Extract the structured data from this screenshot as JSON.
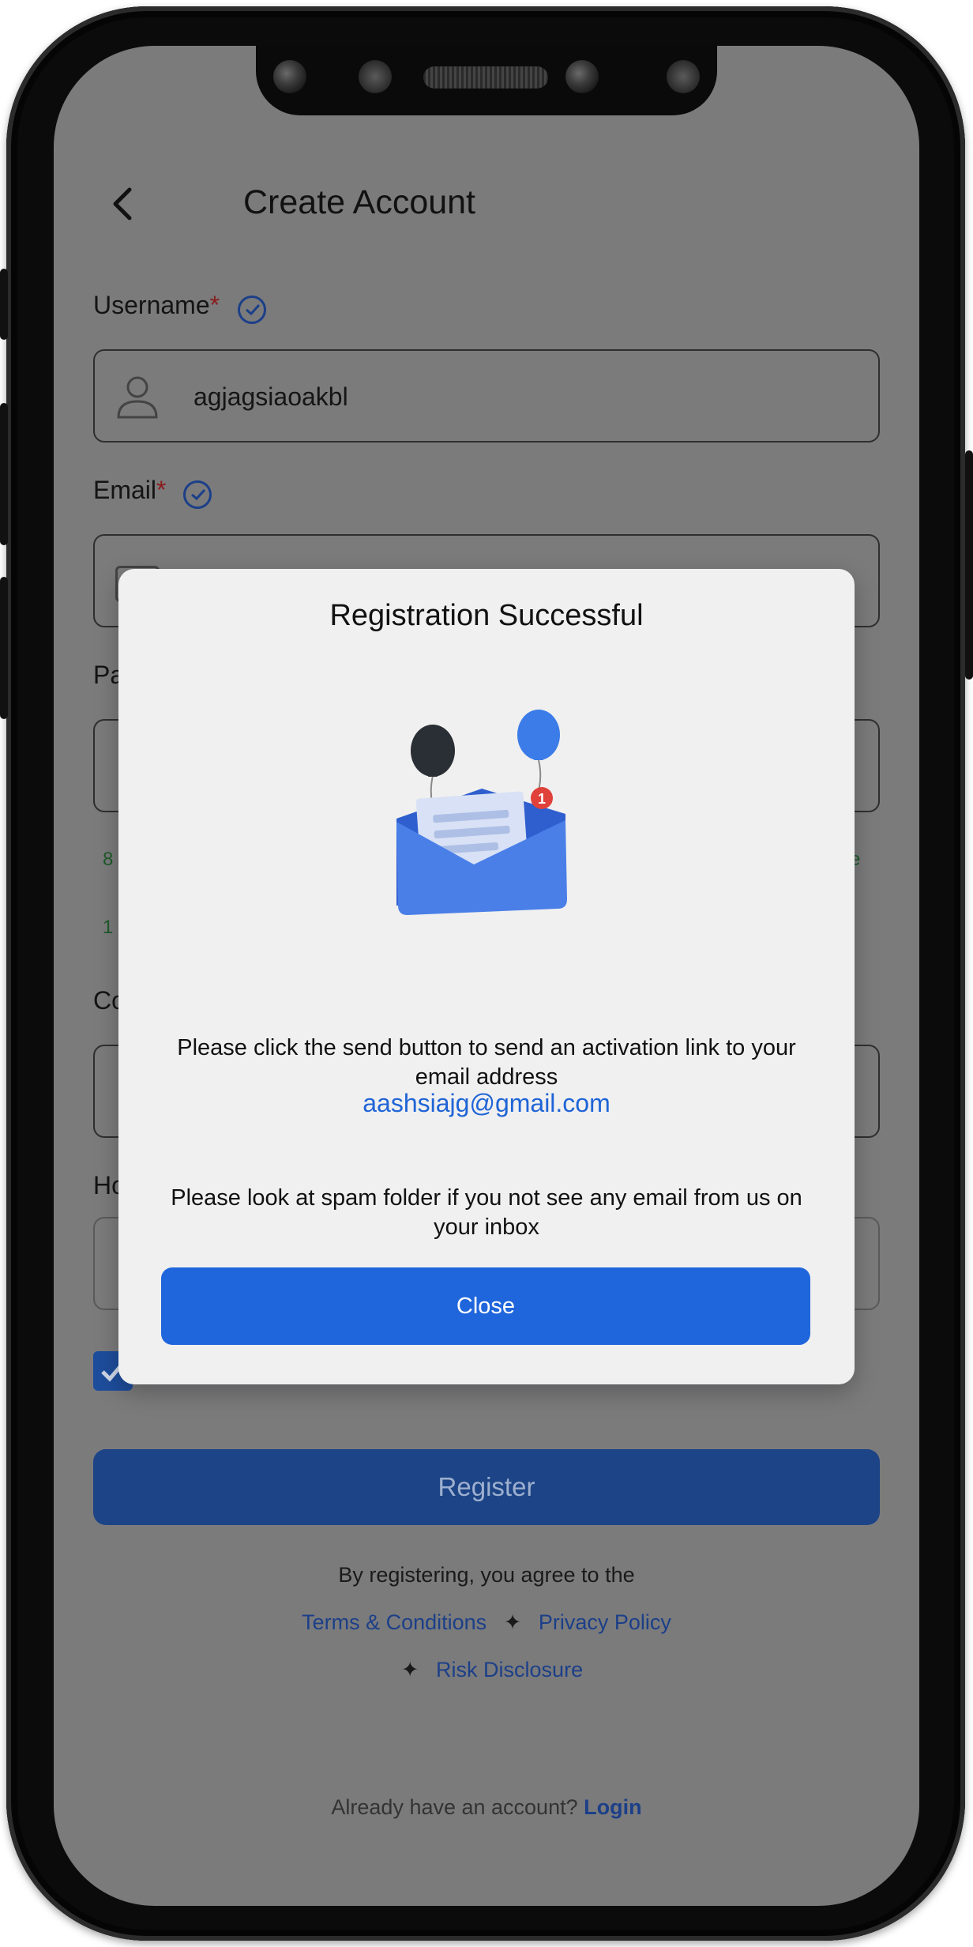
{
  "header": {
    "title": "Create Account"
  },
  "form": {
    "username_label": "Username",
    "email_label": "Email",
    "required_mark": "*",
    "username_value": "agjagsiaoakbl",
    "password_label_partial": "Pa",
    "confirm_label_partial": "Co",
    "hint_label_partial": "Ho",
    "helper_left_1": "8",
    "helper_left_2": "1",
    "helper_right_1": "e"
  },
  "register": {
    "label": "Register"
  },
  "legal": {
    "agree_text": "By registering, you agree to the",
    "terms": "Terms & Conditions",
    "privacy": "Privacy Policy",
    "risk": "Risk Disclosure",
    "separator": "✦"
  },
  "login": {
    "prompt": "Already have an account?",
    "link": "Login"
  },
  "modal": {
    "title": "Registration Successful",
    "message": "Please click the send button to send an activation link to your email address",
    "email": "aashsiajg@gmail.com",
    "spam_note": "Please look at spam folder if you not see any email from us on your inbox",
    "close_label": "Close",
    "badge_count": "1"
  },
  "colors": {
    "accent": "#1f66dc",
    "link": "#1c3f88",
    "overlay": "#7b7b7c",
    "modal_bg": "#f0f0f0"
  }
}
